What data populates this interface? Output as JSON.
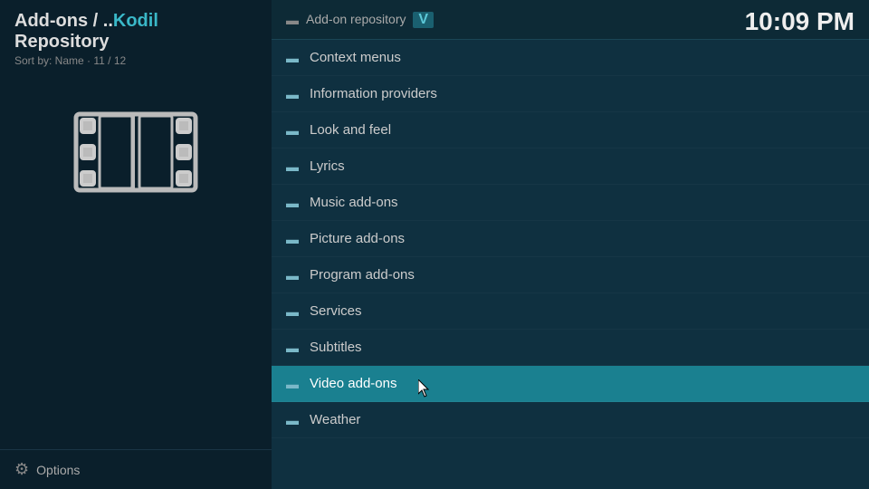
{
  "left": {
    "breadcrumb": "Add-ons / ..",
    "kodil": "Kodil",
    "repository": "Repository",
    "sort_info": "Sort by: Name · 11 / 12",
    "options_label": "Options"
  },
  "header": {
    "addon_type": "Add-on repository",
    "v_badge": "V"
  },
  "clock": "10:09 PM",
  "list_items": [
    {
      "label": "Context menus",
      "selected": false
    },
    {
      "label": "Information providers",
      "selected": false
    },
    {
      "label": "Look and feel",
      "selected": false
    },
    {
      "label": "Lyrics",
      "selected": false
    },
    {
      "label": "Music add-ons",
      "selected": false
    },
    {
      "label": "Picture add-ons",
      "selected": false
    },
    {
      "label": "Program add-ons",
      "selected": false
    },
    {
      "label": "Services",
      "selected": false
    },
    {
      "label": "Subtitles",
      "selected": false
    },
    {
      "label": "Video add-ons",
      "selected": true
    },
    {
      "label": "Weather",
      "selected": false
    }
  ]
}
